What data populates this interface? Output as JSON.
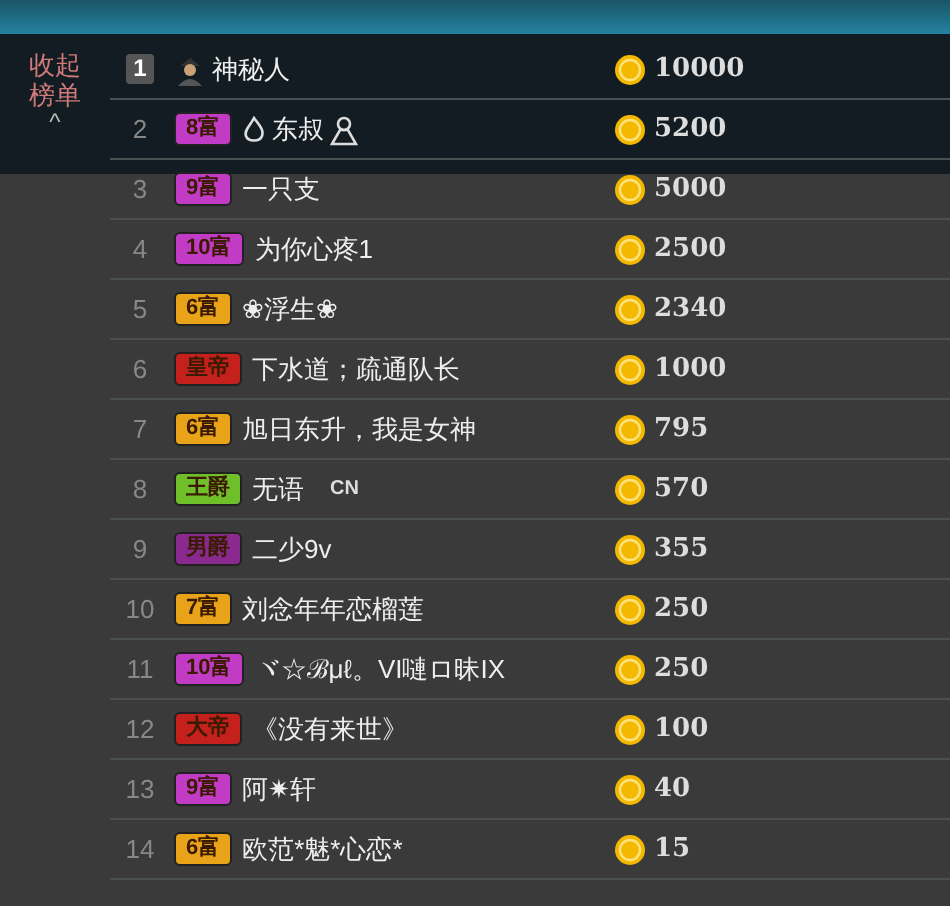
{
  "collapse_button": {
    "label": "收起榜单",
    "caret": "^"
  },
  "ranking": [
    {
      "rank": "1",
      "top": true,
      "kind": "avatar",
      "name": "神秘人",
      "score": "10000"
    },
    {
      "rank": "2",
      "top": false,
      "kind": "badge",
      "badge": "8富",
      "color": "#c23bc4",
      "name": "东叔",
      "flame": true,
      "person": true,
      "score": "5200"
    },
    {
      "rank": "3",
      "top": false,
      "kind": "badge",
      "badge": "9富",
      "color": "#c23bc4",
      "name": "一只支",
      "score": "5000"
    },
    {
      "rank": "4",
      "top": false,
      "kind": "badge",
      "badge": "10富",
      "color": "#c23bc4",
      "name": "为你心疼1",
      "score": "2500"
    },
    {
      "rank": "5",
      "top": false,
      "kind": "badge",
      "badge": "6富",
      "color": "#e8a318",
      "name": "❀浮生❀",
      "score": "2340"
    },
    {
      "rank": "6",
      "top": false,
      "kind": "badge",
      "badge": "皇帝",
      "color": "#c4211c",
      "name": "下水道；疏通队长",
      "score": "1000"
    },
    {
      "rank": "7",
      "top": false,
      "kind": "badge",
      "badge": "6富",
      "color": "#e8a318",
      "name": "旭日东升，我是女神",
      "score": "795"
    },
    {
      "rank": "8",
      "top": false,
      "kind": "badge",
      "badge": "王爵",
      "color": "#6fbf2a",
      "name": "无语",
      "suffix": "CN",
      "score": "570"
    },
    {
      "rank": "9",
      "top": false,
      "kind": "badge",
      "badge": "男爵",
      "color": "#8a2a8e",
      "name": "二少9v",
      "score": "355"
    },
    {
      "rank": "10",
      "top": false,
      "kind": "badge",
      "badge": "7富",
      "color": "#e8a318",
      "name": "刘念年年恋榴莲",
      "score": "250"
    },
    {
      "rank": "11",
      "top": false,
      "kind": "badge",
      "badge": "10富",
      "color": "#c23bc4",
      "name": "ヾ☆ℬμℓ。VI嗹ロ昧IX",
      "score": "250"
    },
    {
      "rank": "12",
      "top": false,
      "kind": "badge",
      "badge": "大帝",
      "color": "#c4211c",
      "name": "《没有来世》",
      "score": "100"
    },
    {
      "rank": "13",
      "top": false,
      "kind": "badge",
      "badge": "9富",
      "color": "#c23bc4",
      "name": "阿✷轩",
      "score": "40"
    },
    {
      "rank": "14",
      "top": false,
      "kind": "badge",
      "badge": "6富",
      "color": "#e8a318",
      "name": "欧范*魅*心恋*",
      "score": "15"
    }
  ]
}
